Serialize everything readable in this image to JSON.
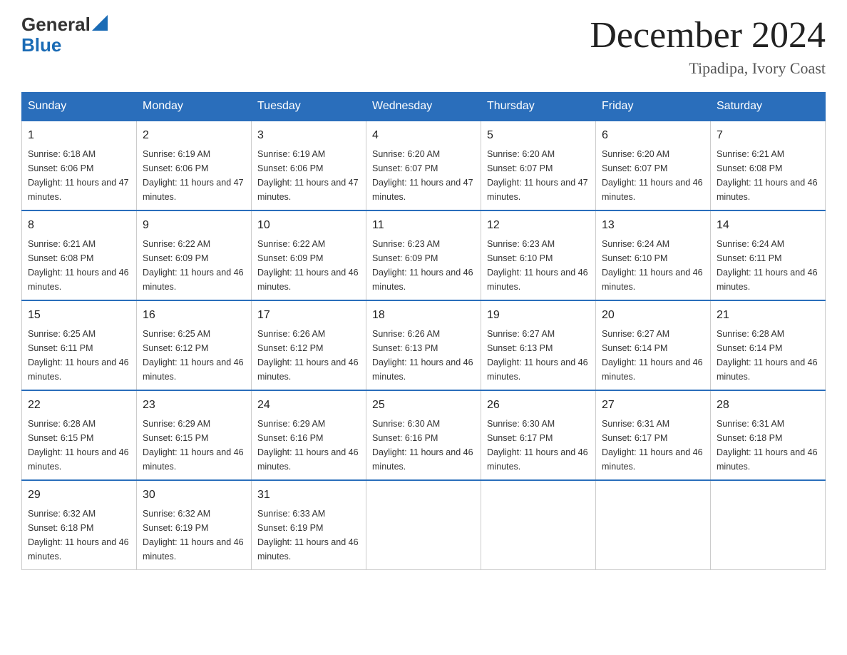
{
  "header": {
    "logo_general": "General",
    "logo_blue": "Blue",
    "month_title": "December 2024",
    "location": "Tipadipa, Ivory Coast"
  },
  "weekdays": [
    "Sunday",
    "Monday",
    "Tuesday",
    "Wednesday",
    "Thursday",
    "Friday",
    "Saturday"
  ],
  "weeks": [
    [
      {
        "day": "1",
        "sunrise": "6:18 AM",
        "sunset": "6:06 PM",
        "daylight": "11 hours and 47 minutes."
      },
      {
        "day": "2",
        "sunrise": "6:19 AM",
        "sunset": "6:06 PM",
        "daylight": "11 hours and 47 minutes."
      },
      {
        "day": "3",
        "sunrise": "6:19 AM",
        "sunset": "6:06 PM",
        "daylight": "11 hours and 47 minutes."
      },
      {
        "day": "4",
        "sunrise": "6:20 AM",
        "sunset": "6:07 PM",
        "daylight": "11 hours and 47 minutes."
      },
      {
        "day": "5",
        "sunrise": "6:20 AM",
        "sunset": "6:07 PM",
        "daylight": "11 hours and 47 minutes."
      },
      {
        "day": "6",
        "sunrise": "6:20 AM",
        "sunset": "6:07 PM",
        "daylight": "11 hours and 46 minutes."
      },
      {
        "day": "7",
        "sunrise": "6:21 AM",
        "sunset": "6:08 PM",
        "daylight": "11 hours and 46 minutes."
      }
    ],
    [
      {
        "day": "8",
        "sunrise": "6:21 AM",
        "sunset": "6:08 PM",
        "daylight": "11 hours and 46 minutes."
      },
      {
        "day": "9",
        "sunrise": "6:22 AM",
        "sunset": "6:09 PM",
        "daylight": "11 hours and 46 minutes."
      },
      {
        "day": "10",
        "sunrise": "6:22 AM",
        "sunset": "6:09 PM",
        "daylight": "11 hours and 46 minutes."
      },
      {
        "day": "11",
        "sunrise": "6:23 AM",
        "sunset": "6:09 PM",
        "daylight": "11 hours and 46 minutes."
      },
      {
        "day": "12",
        "sunrise": "6:23 AM",
        "sunset": "6:10 PM",
        "daylight": "11 hours and 46 minutes."
      },
      {
        "day": "13",
        "sunrise": "6:24 AM",
        "sunset": "6:10 PM",
        "daylight": "11 hours and 46 minutes."
      },
      {
        "day": "14",
        "sunrise": "6:24 AM",
        "sunset": "6:11 PM",
        "daylight": "11 hours and 46 minutes."
      }
    ],
    [
      {
        "day": "15",
        "sunrise": "6:25 AM",
        "sunset": "6:11 PM",
        "daylight": "11 hours and 46 minutes."
      },
      {
        "day": "16",
        "sunrise": "6:25 AM",
        "sunset": "6:12 PM",
        "daylight": "11 hours and 46 minutes."
      },
      {
        "day": "17",
        "sunrise": "6:26 AM",
        "sunset": "6:12 PM",
        "daylight": "11 hours and 46 minutes."
      },
      {
        "day": "18",
        "sunrise": "6:26 AM",
        "sunset": "6:13 PM",
        "daylight": "11 hours and 46 minutes."
      },
      {
        "day": "19",
        "sunrise": "6:27 AM",
        "sunset": "6:13 PM",
        "daylight": "11 hours and 46 minutes."
      },
      {
        "day": "20",
        "sunrise": "6:27 AM",
        "sunset": "6:14 PM",
        "daylight": "11 hours and 46 minutes."
      },
      {
        "day": "21",
        "sunrise": "6:28 AM",
        "sunset": "6:14 PM",
        "daylight": "11 hours and 46 minutes."
      }
    ],
    [
      {
        "day": "22",
        "sunrise": "6:28 AM",
        "sunset": "6:15 PM",
        "daylight": "11 hours and 46 minutes."
      },
      {
        "day": "23",
        "sunrise": "6:29 AM",
        "sunset": "6:15 PM",
        "daylight": "11 hours and 46 minutes."
      },
      {
        "day": "24",
        "sunrise": "6:29 AM",
        "sunset": "6:16 PM",
        "daylight": "11 hours and 46 minutes."
      },
      {
        "day": "25",
        "sunrise": "6:30 AM",
        "sunset": "6:16 PM",
        "daylight": "11 hours and 46 minutes."
      },
      {
        "day": "26",
        "sunrise": "6:30 AM",
        "sunset": "6:17 PM",
        "daylight": "11 hours and 46 minutes."
      },
      {
        "day": "27",
        "sunrise": "6:31 AM",
        "sunset": "6:17 PM",
        "daylight": "11 hours and 46 minutes."
      },
      {
        "day": "28",
        "sunrise": "6:31 AM",
        "sunset": "6:18 PM",
        "daylight": "11 hours and 46 minutes."
      }
    ],
    [
      {
        "day": "29",
        "sunrise": "6:32 AM",
        "sunset": "6:18 PM",
        "daylight": "11 hours and 46 minutes."
      },
      {
        "day": "30",
        "sunrise": "6:32 AM",
        "sunset": "6:19 PM",
        "daylight": "11 hours and 46 minutes."
      },
      {
        "day": "31",
        "sunrise": "6:33 AM",
        "sunset": "6:19 PM",
        "daylight": "11 hours and 46 minutes."
      },
      null,
      null,
      null,
      null
    ]
  ]
}
